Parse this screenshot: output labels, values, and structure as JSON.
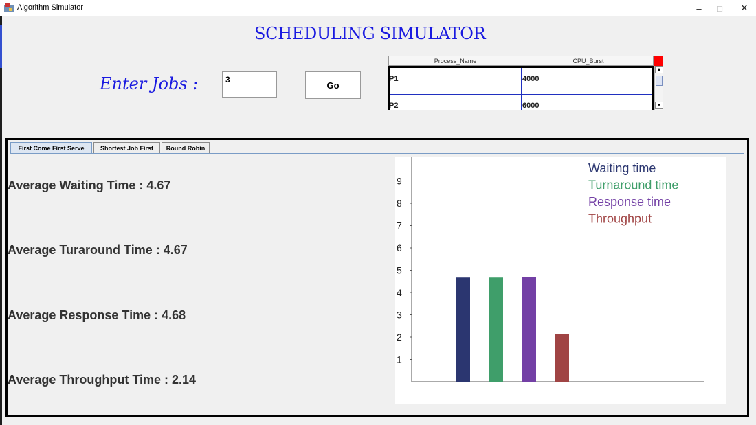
{
  "window": {
    "title": "Algorithm Simulator",
    "minimize_glyph": "–",
    "maximize_glyph": "□",
    "close_glyph": "✕"
  },
  "heading": "SCHEDULING SIMULATOR",
  "jobs": {
    "label": "Enter Jobs :",
    "value": "3",
    "go_label": "Go"
  },
  "process_table": {
    "columns": [
      "Process_Name",
      "CPU_Burst"
    ],
    "rows": [
      [
        "P1",
        "4000"
      ],
      [
        "P2",
        "6000"
      ]
    ]
  },
  "tabs": [
    {
      "label": "First Come First Serve",
      "active": true
    },
    {
      "label": "Shortest Job First",
      "active": false
    },
    {
      "label": "Round Robin",
      "active": false
    }
  ],
  "stats": {
    "waiting": "Average Waiting Time : 4.67",
    "turnaround": "Average Turaround Time : 4.67",
    "response": "Average Response Time : 4.68",
    "throughput": "Average Throughput Time : 2.14"
  },
  "chart_data": {
    "type": "bar",
    "categories": [
      "Waiting time",
      "Turnaround time",
      "Response time",
      "Throughput"
    ],
    "values": [
      4.67,
      4.67,
      4.68,
      2.14
    ],
    "colors": [
      "#2b3670",
      "#3f9e6a",
      "#7340a5",
      "#a04444"
    ],
    "yticks": [
      1,
      2,
      3,
      4,
      5,
      6,
      7,
      8,
      9
    ],
    "ylim": [
      0,
      10
    ],
    "legend": [
      "Waiting time",
      "Turnaround time",
      "Response time",
      "Throughput"
    ],
    "legend_position": "top-right",
    "grid": false
  },
  "colors": {
    "heading": "#1a1ae0",
    "close_corner": "#ff0000"
  }
}
